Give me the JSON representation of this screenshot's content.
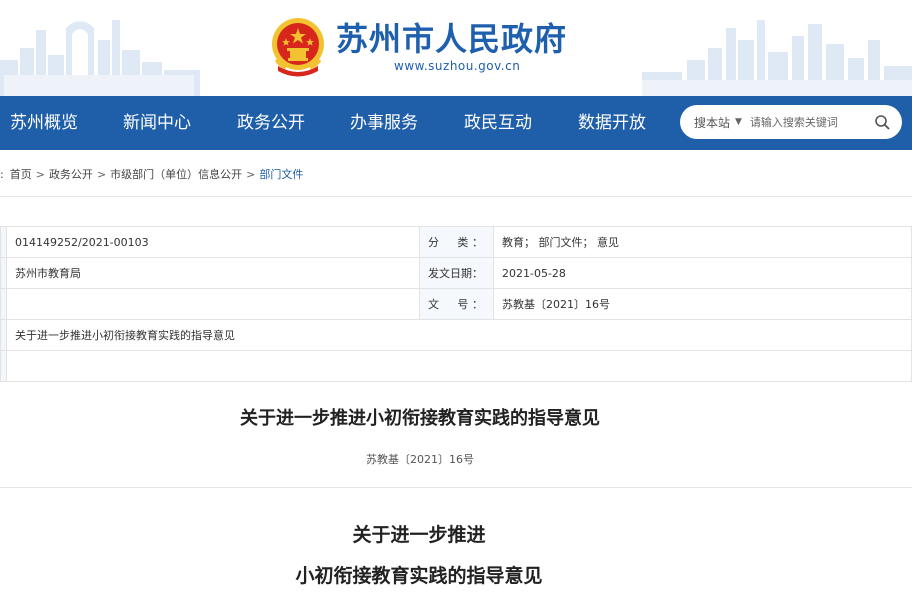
{
  "site": {
    "name": "苏州市人民政府",
    "url": "www.suzhou.gov.cn"
  },
  "nav": {
    "items": [
      {
        "label": "苏州概览"
      },
      {
        "label": "新闻中心"
      },
      {
        "label": "政务公开"
      },
      {
        "label": "办事服务"
      },
      {
        "label": "政民互动"
      },
      {
        "label": "数据开放"
      }
    ]
  },
  "search": {
    "scope": "搜本站",
    "placeholder": "请输入搜索关键词"
  },
  "breadcrumb": {
    "prefix": ":",
    "items": [
      "首页",
      "政务公开",
      "市级部门（单位）信息公开",
      "部门文件"
    ],
    "separator": ">"
  },
  "meta": {
    "index_no": "014149252/2021-00103",
    "publisher": "苏州市教育局",
    "subject": "关于进一步推进小初衔接教育实践的指导意见",
    "category_label": "分　类：",
    "category_value": "教育； 部门文件； 意见",
    "date_label": "发文日期：",
    "date_value": "2021-05-28",
    "docno_label": "文　号：",
    "docno_value": "苏教基〔2021〕16号"
  },
  "article": {
    "title": "关于进一步推进小初衔接教育实践的指导意见",
    "doc_no": "苏教基〔2021〕16号",
    "body_heading_line1": "关于进一步推进",
    "body_heading_line2": "小初衔接教育实践的指导意见"
  },
  "colors": {
    "brand_blue": "#1f5ea9",
    "title_blue": "#1e5fae",
    "emblem_red": "#d7261c",
    "emblem_gold": "#f2c230"
  }
}
